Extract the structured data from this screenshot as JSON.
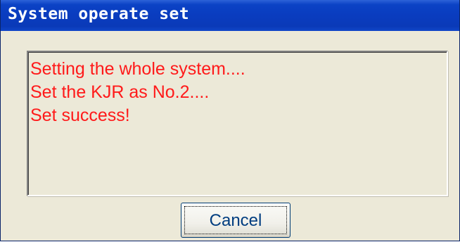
{
  "window": {
    "title": "System operate set"
  },
  "messages": [
    "Setting the whole system....",
    "Set the KJR as No.2....",
    "Set success!"
  ],
  "buttons": {
    "cancel_label": "Cancel"
  },
  "colors": {
    "titlebar": "#0a3cbf",
    "title_text": "#ffffff",
    "dialog_background": "#ece9d8",
    "message_text": "#ff1a1a",
    "button_text": "#003d80"
  }
}
